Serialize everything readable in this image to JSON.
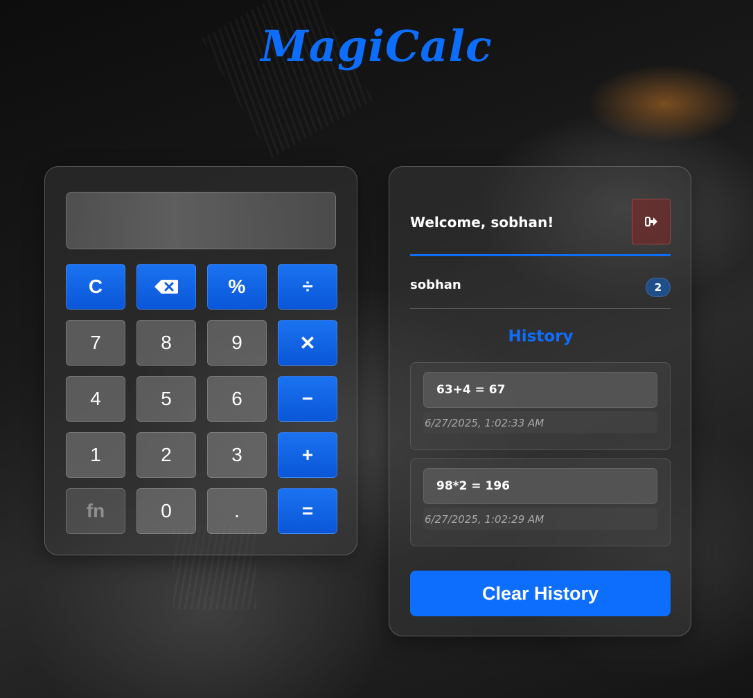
{
  "app": {
    "title": "MagiCalc"
  },
  "calculator": {
    "display_value": "",
    "keys": [
      {
        "label": "C",
        "kind": "op",
        "name": "clear-key"
      },
      {
        "label": "",
        "kind": "op",
        "name": "backspace-key",
        "icon": "backspace-icon"
      },
      {
        "label": "%",
        "kind": "op",
        "name": "percent-key"
      },
      {
        "label": "÷",
        "kind": "op",
        "name": "divide-key"
      },
      {
        "label": "7",
        "kind": "num",
        "name": "digit-7-key"
      },
      {
        "label": "8",
        "kind": "num",
        "name": "digit-8-key"
      },
      {
        "label": "9",
        "kind": "num",
        "name": "digit-9-key"
      },
      {
        "label": "✕",
        "kind": "op",
        "name": "multiply-key"
      },
      {
        "label": "4",
        "kind": "num",
        "name": "digit-4-key"
      },
      {
        "label": "5",
        "kind": "num",
        "name": "digit-5-key"
      },
      {
        "label": "6",
        "kind": "num",
        "name": "digit-6-key"
      },
      {
        "label": "−",
        "kind": "op",
        "name": "minus-key"
      },
      {
        "label": "1",
        "kind": "num",
        "name": "digit-1-key"
      },
      {
        "label": "2",
        "kind": "num",
        "name": "digit-2-key"
      },
      {
        "label": "3",
        "kind": "num",
        "name": "digit-3-key"
      },
      {
        "label": "+",
        "kind": "op",
        "name": "plus-key"
      },
      {
        "label": "fn",
        "kind": "fn",
        "name": "fn-key"
      },
      {
        "label": "0",
        "kind": "num",
        "name": "digit-0-key"
      },
      {
        "label": ".",
        "kind": "num",
        "name": "decimal-key"
      },
      {
        "label": "=",
        "kind": "op",
        "name": "equals-key"
      }
    ]
  },
  "sidebar": {
    "welcome": "Welcome, sobhan!",
    "logout_icon": "sign-out-icon",
    "user": {
      "name": "sobhan",
      "count": "2"
    },
    "history_title": "History",
    "history": [
      {
        "expression": "63+4 = 67",
        "timestamp": "6/27/2025, 1:02:33 AM"
      },
      {
        "expression": "98*2 = 196",
        "timestamp": "6/27/2025, 1:02:29 AM"
      }
    ],
    "clear_label": "Clear History"
  },
  "colors": {
    "accent": "#0d6efd",
    "logout": "#7a2e2e"
  }
}
